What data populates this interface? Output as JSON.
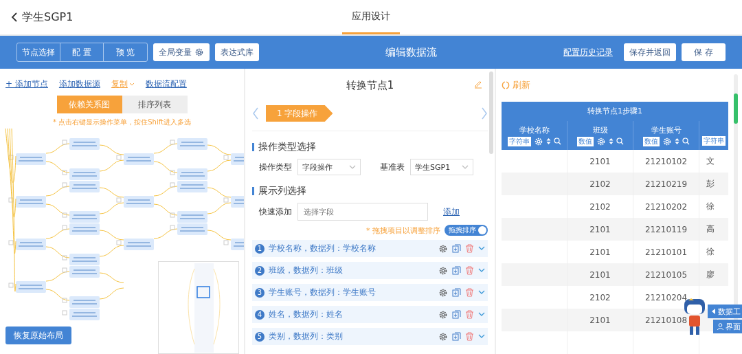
{
  "header": {
    "back_title": "学生SGP1",
    "tabs": [
      {
        "label": "应用设计",
        "selected": true
      }
    ]
  },
  "toolbar": {
    "mode_tabs": [
      {
        "label": "节点选择",
        "selected": false
      },
      {
        "label": "配 置",
        "selected": false
      },
      {
        "label": "预 览",
        "selected": false
      }
    ],
    "global_var": "全局变量",
    "expr_lib": "表达式库",
    "title": "编辑数据流",
    "history_link": "配置历史记录",
    "save_return": "保存并返回",
    "save": "保 存"
  },
  "left": {
    "actions": [
      {
        "label": "+ 添加节点",
        "kind": "link"
      },
      {
        "label": "添加数据源",
        "kind": "link"
      },
      {
        "label": "复制",
        "kind": "menu"
      },
      {
        "label": "数据流配置",
        "kind": "link"
      }
    ],
    "view_tabs": [
      {
        "label": "依赖关系图",
        "selected": true
      },
      {
        "label": "排序列表",
        "selected": false
      }
    ],
    "hint": "* 点击右键显示操作菜单，按住Shift进入多选",
    "restore_button": "恢复原始布局"
  },
  "middle": {
    "title": "转换节点1",
    "step": "1 字段操作",
    "section_1": "操作类型选择",
    "fields": [
      {
        "label": "操作类型",
        "value": "字段操作"
      },
      {
        "label": "基准表",
        "value": "学生SGP1"
      }
    ],
    "section_2": "展示列选择",
    "quick_add": {
      "label": "快速添加",
      "placeholder": "选择字段",
      "link": "添加"
    },
    "drag_hint": "* 拖拽项目以调整排序",
    "toggle": {
      "label": "拖拽排序",
      "on": true
    },
    "columns": [
      {
        "index": "1",
        "text": "学校名称，数据列：学校名称"
      },
      {
        "index": "2",
        "text": "班级，数据列：班级"
      },
      {
        "index": "3",
        "text": "学生账号，数据列：学生账号"
      },
      {
        "index": "4",
        "text": "姓名，数据列：姓名"
      },
      {
        "index": "5",
        "text": "类别，数据列：类别"
      }
    ]
  },
  "right": {
    "refresh": "刷新",
    "table": {
      "title": "转换节点1步骤1",
      "columns": [
        {
          "name": "学校名称",
          "type": "字符串"
        },
        {
          "name": "班级",
          "type": "数值"
        },
        {
          "name": "学生账号",
          "type": "数值"
        },
        {
          "type": "字符串"
        }
      ],
      "rows": [
        {
          "class": "2101",
          "account": "21210102",
          "name": "文"
        },
        {
          "class": "2102",
          "account": "21210219",
          "name": "彭"
        },
        {
          "class": "2102",
          "account": "21210202",
          "name": "徐"
        },
        {
          "class": "2101",
          "account": "21210119",
          "name": "高"
        },
        {
          "class": "2101",
          "account": "21210101",
          "name": "徐"
        },
        {
          "class": "2101",
          "account": "21210105",
          "name": "廖"
        },
        {
          "class": "2102",
          "account": "21210204"
        },
        {
          "class": "2101",
          "account": "21210108"
        }
      ]
    }
  },
  "side_tabs": [
    "数据工",
    "界面"
  ]
}
